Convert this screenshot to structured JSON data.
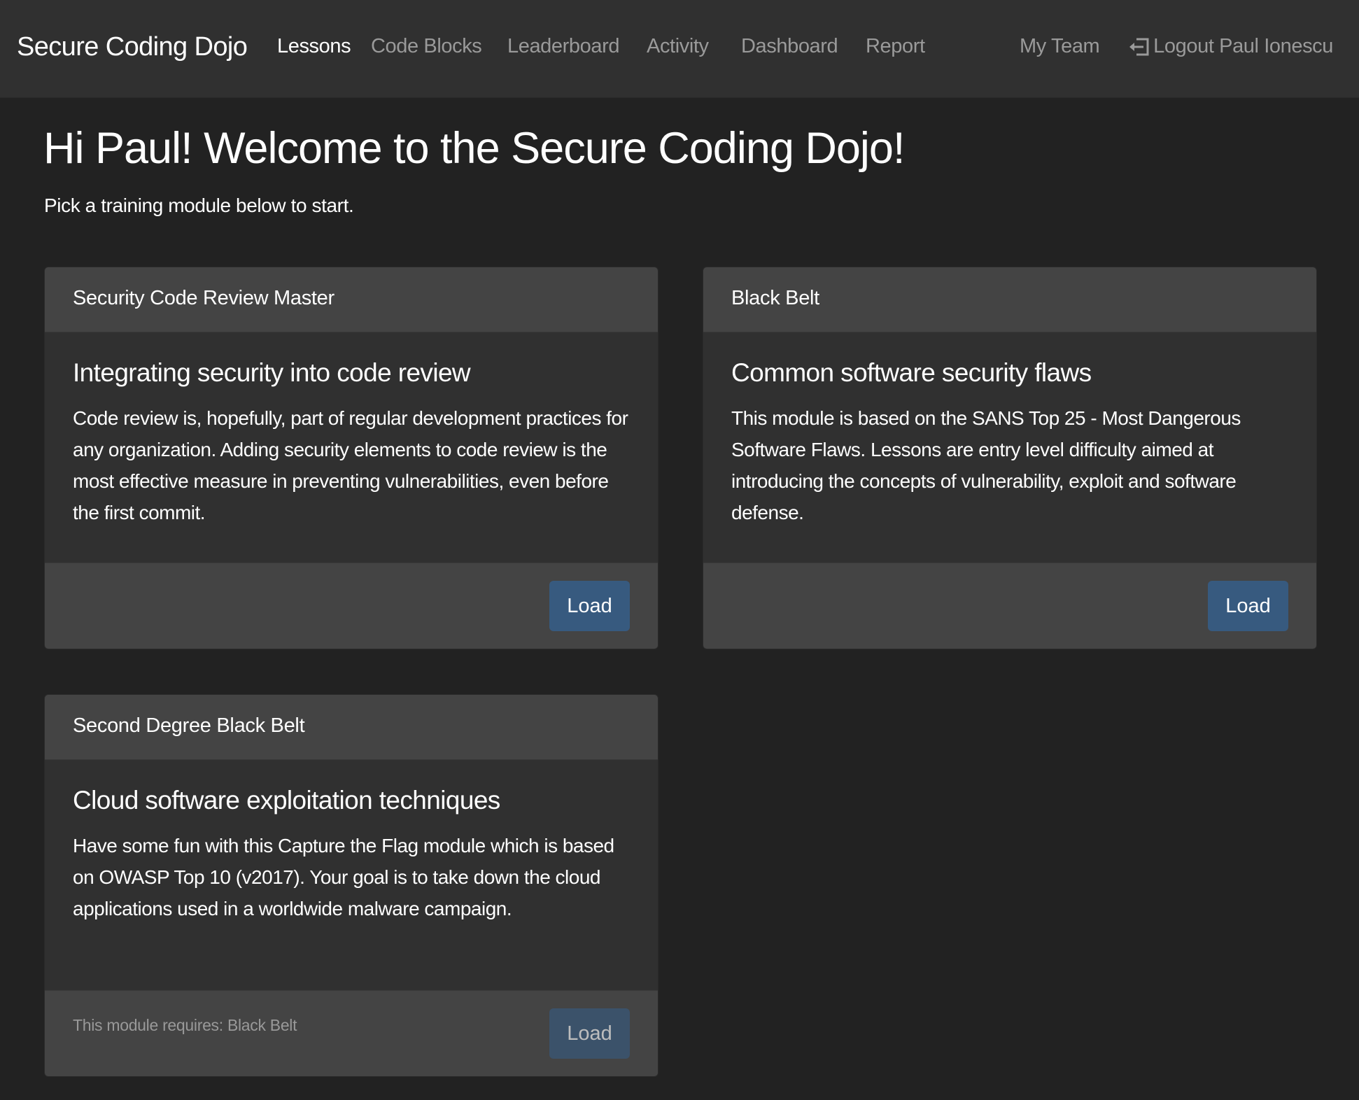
{
  "navbar": {
    "brand": "Secure Coding Dojo",
    "links": [
      {
        "label": "Lessons",
        "active": true
      },
      {
        "label": "Code Blocks",
        "active": false
      },
      {
        "label": "Leaderboard",
        "active": false
      },
      {
        "label": "Activity",
        "active": false
      },
      {
        "label": "Dashboard",
        "active": false
      },
      {
        "label": "Report",
        "active": false
      }
    ],
    "my_team": "My Team",
    "logout_icon": "logout-icon",
    "logout_label": "Logout Paul Ionescu"
  },
  "main": {
    "welcome": "Hi Paul! Welcome to the Secure Coding Dojo!",
    "subtitle": "Pick a training module below to start."
  },
  "modules": [
    {
      "header": "Security Code Review Master",
      "title": "Integrating security into code review",
      "description": "Code review is, hopefully, part of regular development practices for any organization. Adding security elements to code review is the most effective measure in preventing vulnerabilities, even before the first commit.",
      "requirement": "",
      "button_label": "Load",
      "enabled": true
    },
    {
      "header": "Black Belt",
      "title": "Common software security flaws",
      "description": "This module is based on the SANS Top 25 - Most Dangerous Software Flaws. Lessons are entry level difficulty aimed at introducing the concepts of vulnerability, exploit and software defense.",
      "requirement": "",
      "button_label": "Load",
      "enabled": true
    },
    {
      "header": "Second Degree Black Belt",
      "title": "Cloud software exploitation techniques",
      "description": "Have some fun with this Capture the Flag module which is based on OWASP Top 10 (v2017). Your goal is to take down the cloud applications used in a worldwide malware campaign.",
      "requirement": "This module requires: Black Belt",
      "button_label": "Load",
      "enabled": false
    }
  ],
  "colors": {
    "navbar_bg": "#303030",
    "page_bg": "#222222",
    "card_header_bg": "#444444",
    "card_body_bg": "#303030",
    "primary_button": "#375a7f",
    "muted_text": "#999999"
  }
}
